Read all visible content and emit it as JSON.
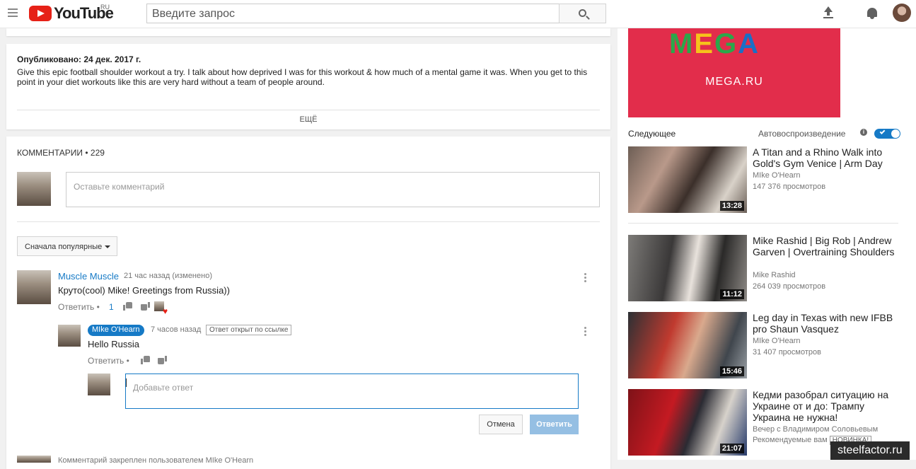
{
  "header": {
    "logo_text": "YouTube",
    "region": "RU",
    "search_placeholder": "Введите запрос"
  },
  "description": {
    "published": "Опубликовано: 24 дек. 2017 г.",
    "text": "Give this epic football shoulder workout a try. I talk about how deprived I was for this workout & how much of a mental game it was. When you get to this point in your diet workouts like this are very hard without a team of people around.",
    "more_label": "ЕЩЁ"
  },
  "comments": {
    "header": "КОММЕНТАРИИ • 229",
    "compose_placeholder": "Оставьте комментарий",
    "sort_label": "Сначала популярные",
    "items": [
      {
        "author": "Muscle Muscle",
        "time": "21 час назад (изменено)",
        "text": "Круто(cool) Mike! Greetings from Russia))",
        "reply_label": "Ответить",
        "likes": "1",
        "reply": {
          "author": "MIke O'Hearn",
          "time": "7 часов назад",
          "link_badge": "Ответ открыт по ссылке",
          "text": "Hello Russia",
          "reply_label": "Ответить"
        }
      }
    ],
    "answer_placeholder": "Добавьте ответ",
    "cancel_label": "Отмена",
    "submit_label": "Ответить",
    "pinned_text": "Комментарий закреплен пользователем MIke O'Hearn"
  },
  "sidebar": {
    "ad": {
      "brand": "MEGA",
      "url": "MEGA.RU"
    },
    "next_label": "Следующее",
    "autoplay_label": "Автовоспроизведение",
    "autoplay_on": true,
    "videos": [
      {
        "title": "A Titan and a Rhino Walk into Gold's Gym Venice | Arm Day",
        "channel": "MIke O'Hearn",
        "views": "147 376 просмотров",
        "duration": "13:28"
      },
      {
        "title": "Mike Rashid | Big Rob | Andrew Garven | Overtraining Shoulders",
        "channel": "Mike Rashid",
        "views": "264 039 просмотров",
        "duration": "11:12"
      },
      {
        "title": "Leg day in Texas with new IFBB pro Shaun Vasquez",
        "channel": "MIke O'Hearn",
        "views": "31 407 просмотров",
        "duration": "15:46"
      },
      {
        "title": "Кедми разобрал ситуацию на Украине от и до: Трампу Украина не нужна!",
        "channel": "Вечер с Владимиром Соловьевым",
        "views": "Рекомендуемые вам",
        "badge": "НОВИНКА!",
        "duration": "21:07"
      }
    ]
  },
  "watermark": "steelfactor.ru",
  "colors": {
    "accent": "#167ac6",
    "youtube_red": "#e62117"
  }
}
